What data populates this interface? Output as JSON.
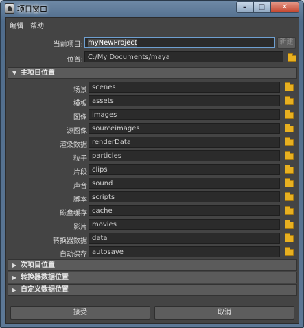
{
  "window": {
    "title": "项目窗口",
    "min_label": "–",
    "max_label": "□",
    "close_label": "✕"
  },
  "menubar": {
    "items": [
      "编辑",
      "帮助"
    ]
  },
  "project": {
    "current_label": "当前项目:",
    "current_value": "myNewProject",
    "new_button": "新建",
    "location_label": "位置:",
    "location_value": "C:/My Documents/maya"
  },
  "sections": [
    {
      "label": "主项目位置",
      "expanded": true
    },
    {
      "label": "次项目位置",
      "expanded": false
    },
    {
      "label": "转换器数据位置",
      "expanded": false
    },
    {
      "label": "自定义数据位置",
      "expanded": false
    }
  ],
  "primary_locations": [
    {
      "label": "场景",
      "value": "scenes"
    },
    {
      "label": "模板",
      "value": "assets"
    },
    {
      "label": "图像",
      "value": "images"
    },
    {
      "label": "源图像",
      "value": "sourceimages"
    },
    {
      "label": "渲染数据",
      "value": "renderData"
    },
    {
      "label": "粒子",
      "value": "particles"
    },
    {
      "label": "片段",
      "value": "clips"
    },
    {
      "label": "声音",
      "value": "sound"
    },
    {
      "label": "脚本",
      "value": "scripts"
    },
    {
      "label": "磁盘缓存",
      "value": "cache"
    },
    {
      "label": "影片",
      "value": "movies"
    },
    {
      "label": "转换器数据",
      "value": "data"
    },
    {
      "label": "自动保存",
      "value": "autosave"
    }
  ],
  "buttons": {
    "accept": "接受",
    "cancel": "取消"
  },
  "icons": {
    "folder": "folder-icon",
    "expand": "triangle-down-icon",
    "collapse": "triangle-right-icon"
  },
  "colors": {
    "folder": "#e8b020",
    "panel": "#444444",
    "field": "#2b2b2b",
    "focus": "#6e9fd0"
  }
}
